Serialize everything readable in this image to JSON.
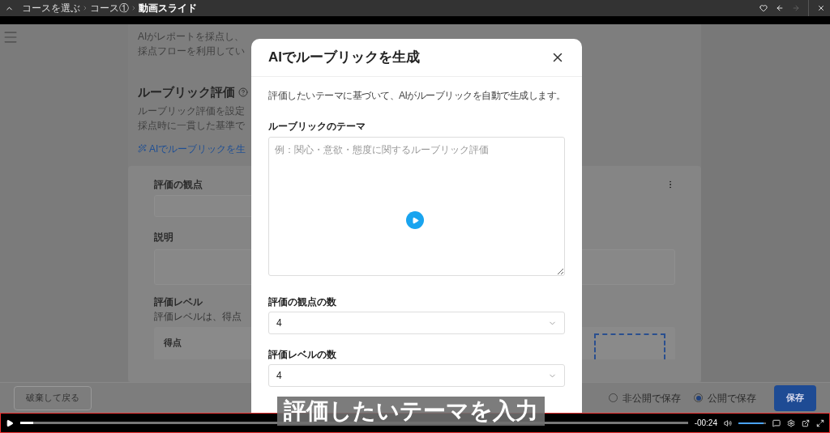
{
  "top_bar": {
    "breadcrumbs": [
      {
        "label": "コースを選ぶ",
        "current": false
      },
      {
        "label": "コース①",
        "current": false
      },
      {
        "label": "動画スライド",
        "current": true
      }
    ]
  },
  "page": {
    "intro_lines": [
      "AIがレポートを採点し、",
      "採点フローを利用してい"
    ],
    "section_title": "ルーブリック評価",
    "section_lines": [
      "ルーブリック評価を設定",
      "採点時に一貫した基準で"
    ],
    "ai_link": "AIでルーブリックを生",
    "criterion": {
      "label": "評価の観点",
      "description_label": "説明",
      "levels_title": "評価レベル",
      "levels_hint": "評価レベルは、得点",
      "score_header": "得点"
    }
  },
  "footer": {
    "discard": "破棄して戻る",
    "visibility": [
      {
        "label": "非公開で保存",
        "selected": false
      },
      {
        "label": "公開で保存",
        "selected": true
      }
    ],
    "save": "保存"
  },
  "modal": {
    "title": "AIでルーブリックを生成",
    "description": "評価したいテーマに基づいて、AIがルーブリックを自動で生成します。",
    "theme": {
      "label": "ルーブリックのテーマ",
      "placeholder": "例：関心・意欲・態度に関するルーブリック評価"
    },
    "selects": [
      {
        "label": "評価の観点の数",
        "value": "4"
      },
      {
        "label": "評価レベルの数",
        "value": "4"
      }
    ]
  },
  "caption": "評価したいテーマを入力",
  "player": {
    "progress": {
      "level": 0.02
    },
    "time": "-00:24",
    "volume": {
      "level": 0.9
    }
  }
}
